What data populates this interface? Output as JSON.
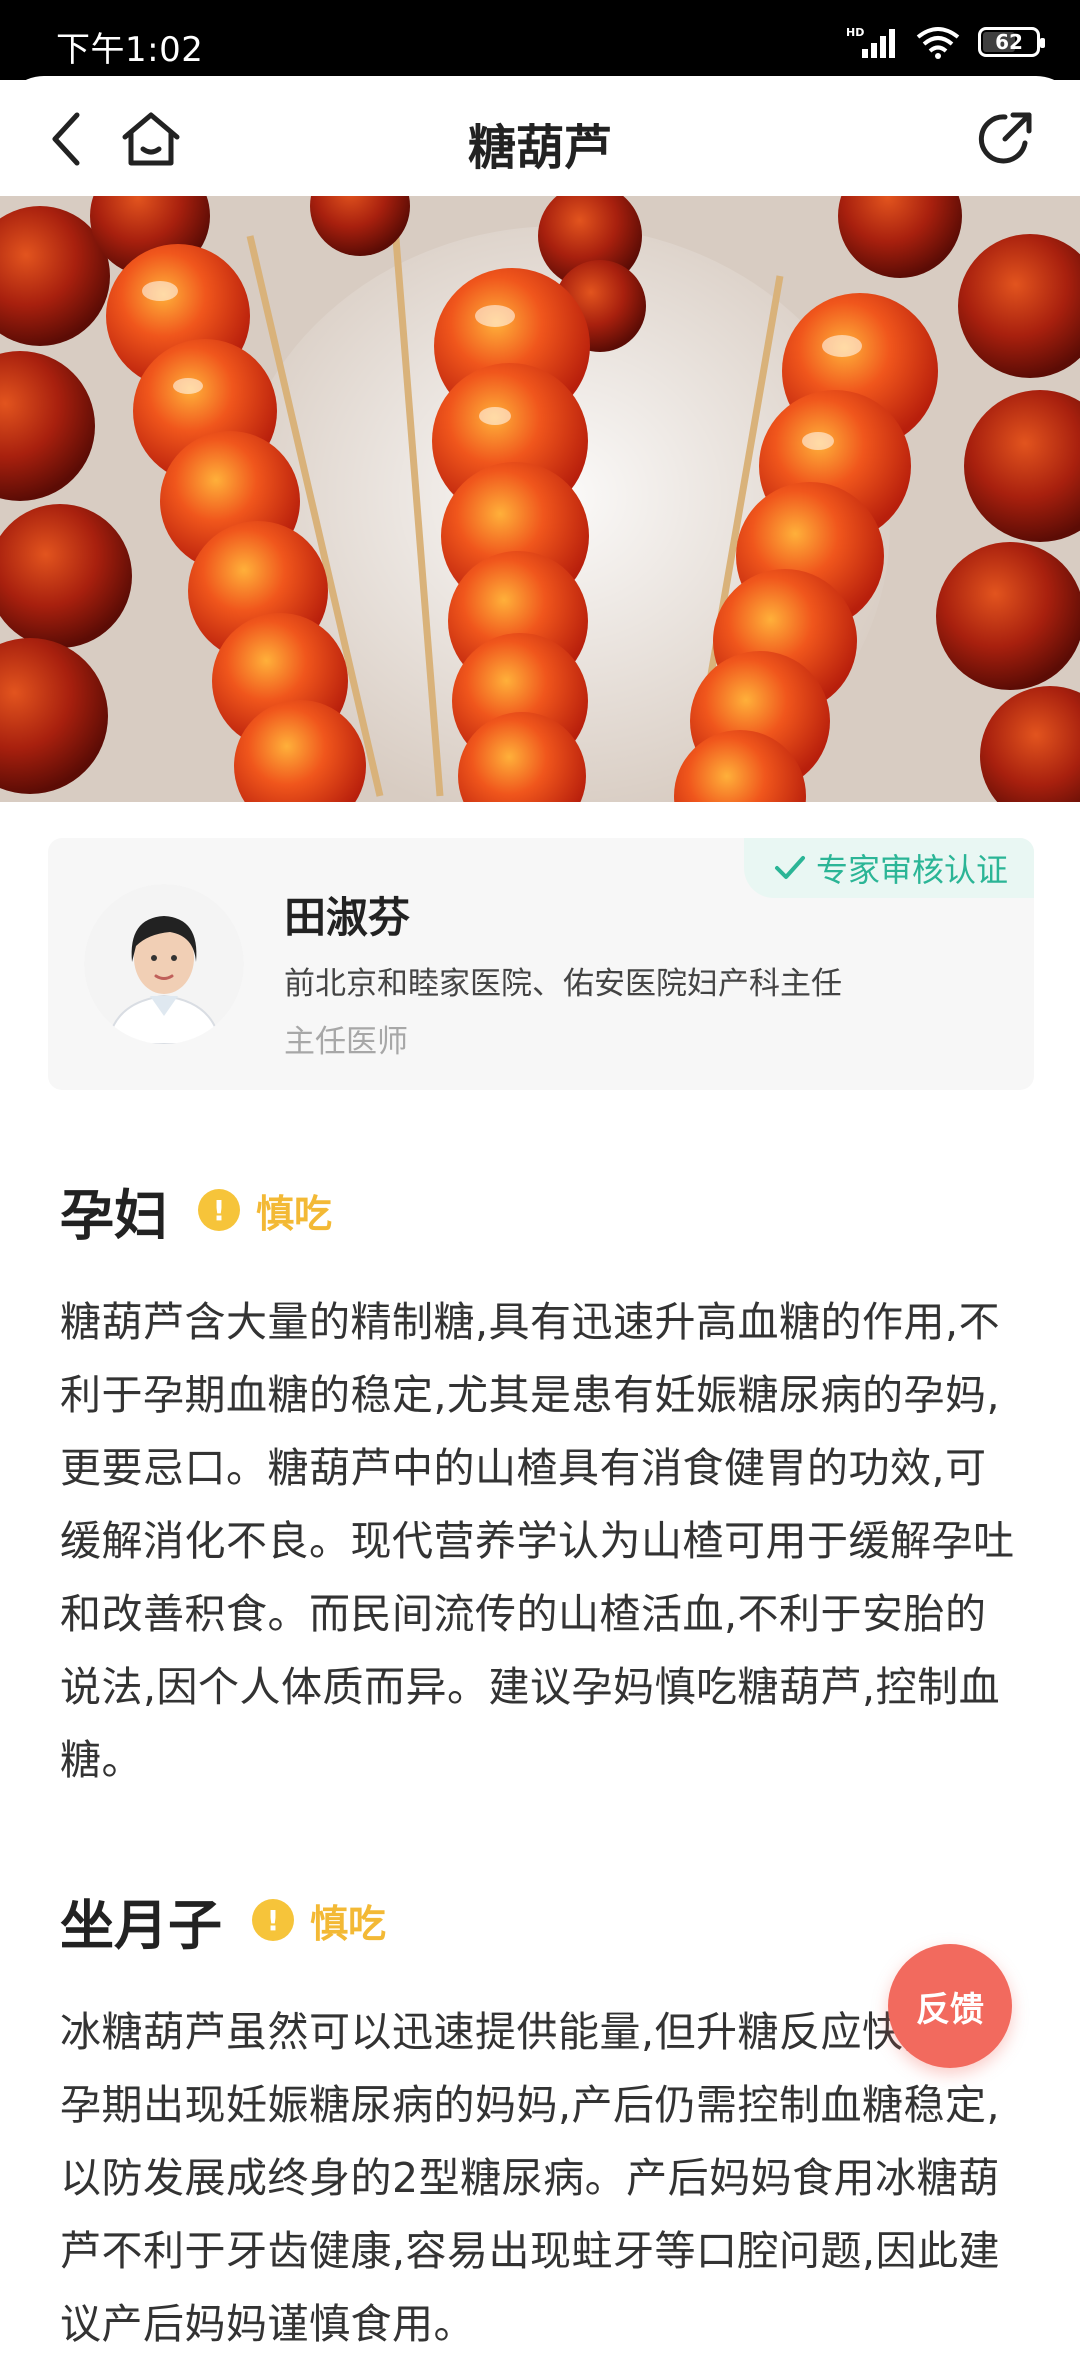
{
  "status_bar": {
    "time": "下午1:02",
    "network": "HD",
    "battery": "62",
    "battery_level": 0.62
  },
  "nav": {
    "title": "糖葫芦",
    "back_icon": "back-arrow-icon",
    "home_icon": "home-icon",
    "share_icon": "share-icon"
  },
  "hero": {
    "icon": "candied-hawthorn-photo"
  },
  "expert": {
    "badge": "专家审核认证",
    "name": "田淑芬",
    "organization": "前北京和睦家医院、佑安医院妇产科主任",
    "title": "主任医师"
  },
  "sections": [
    {
      "title": "孕妇",
      "status": "慎吃",
      "body": "糖葫芦含大量的精制糖,具有迅速升高血糖的作用,不利于孕期血糖的稳定,尤其是患有妊娠糖尿病的孕妈,更要忌口。糖葫芦中的山楂具有消食健胃的功效,可缓解消化不良。现代营养学认为山楂可用于缓解孕吐和改善积食。而民间流传的山楂活血,不利于安胎的说法,因个人体质而异。建议孕妈慎吃糖葫芦,控制血糖。"
    },
    {
      "title": "坐月子",
      "status": "慎吃",
      "body": "冰糖葫芦虽然可以迅速提供能量,但升糖反应快,对于孕期出现妊娠糖尿病的妈妈,产后仍需控制血糖稳定,以防发展成终身的2型糖尿病。产后妈妈食用冰糖葫芦不利于牙齿健康,容易出现蛀牙等口腔问题,因此建议产后妈妈谨慎食用。"
    }
  ],
  "feedback": {
    "label": "反馈"
  },
  "colors": {
    "accent_green": "#2bb596",
    "warn_yellow": "#f6c43a",
    "feedback_red": "#f26a5e"
  }
}
